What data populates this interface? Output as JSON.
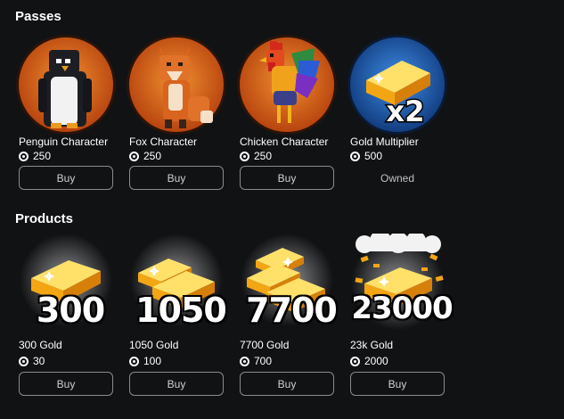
{
  "passes": {
    "title": "Passes",
    "items": [
      {
        "name": "Penguin Character",
        "price": "250",
        "action": "Buy",
        "icon": "penguin-icon"
      },
      {
        "name": "Fox Character",
        "price": "250",
        "action": "Buy",
        "icon": "fox-icon"
      },
      {
        "name": "Chicken Character",
        "price": "250",
        "action": "Buy",
        "icon": "chicken-icon"
      },
      {
        "name": "Gold Multiplier",
        "price": "500",
        "status": "Owned",
        "badge": "x2",
        "icon": "gold-bar-icon"
      }
    ]
  },
  "products": {
    "title": "Products",
    "items": [
      {
        "name": "300 Gold",
        "price": "30",
        "action": "Buy",
        "amount": "300"
      },
      {
        "name": "1050 Gold",
        "price": "100",
        "action": "Buy",
        "amount": "1050"
      },
      {
        "name": "7700 Gold",
        "price": "700",
        "action": "Buy",
        "amount": "7700"
      },
      {
        "name": "23k Gold",
        "price": "2000",
        "action": "Buy",
        "amount": "23000"
      }
    ]
  },
  "colors": {
    "background": "#111214",
    "orange_ring": "#c4561c",
    "blue_ring": "#1b4f9a",
    "gold": "#f6a713"
  }
}
